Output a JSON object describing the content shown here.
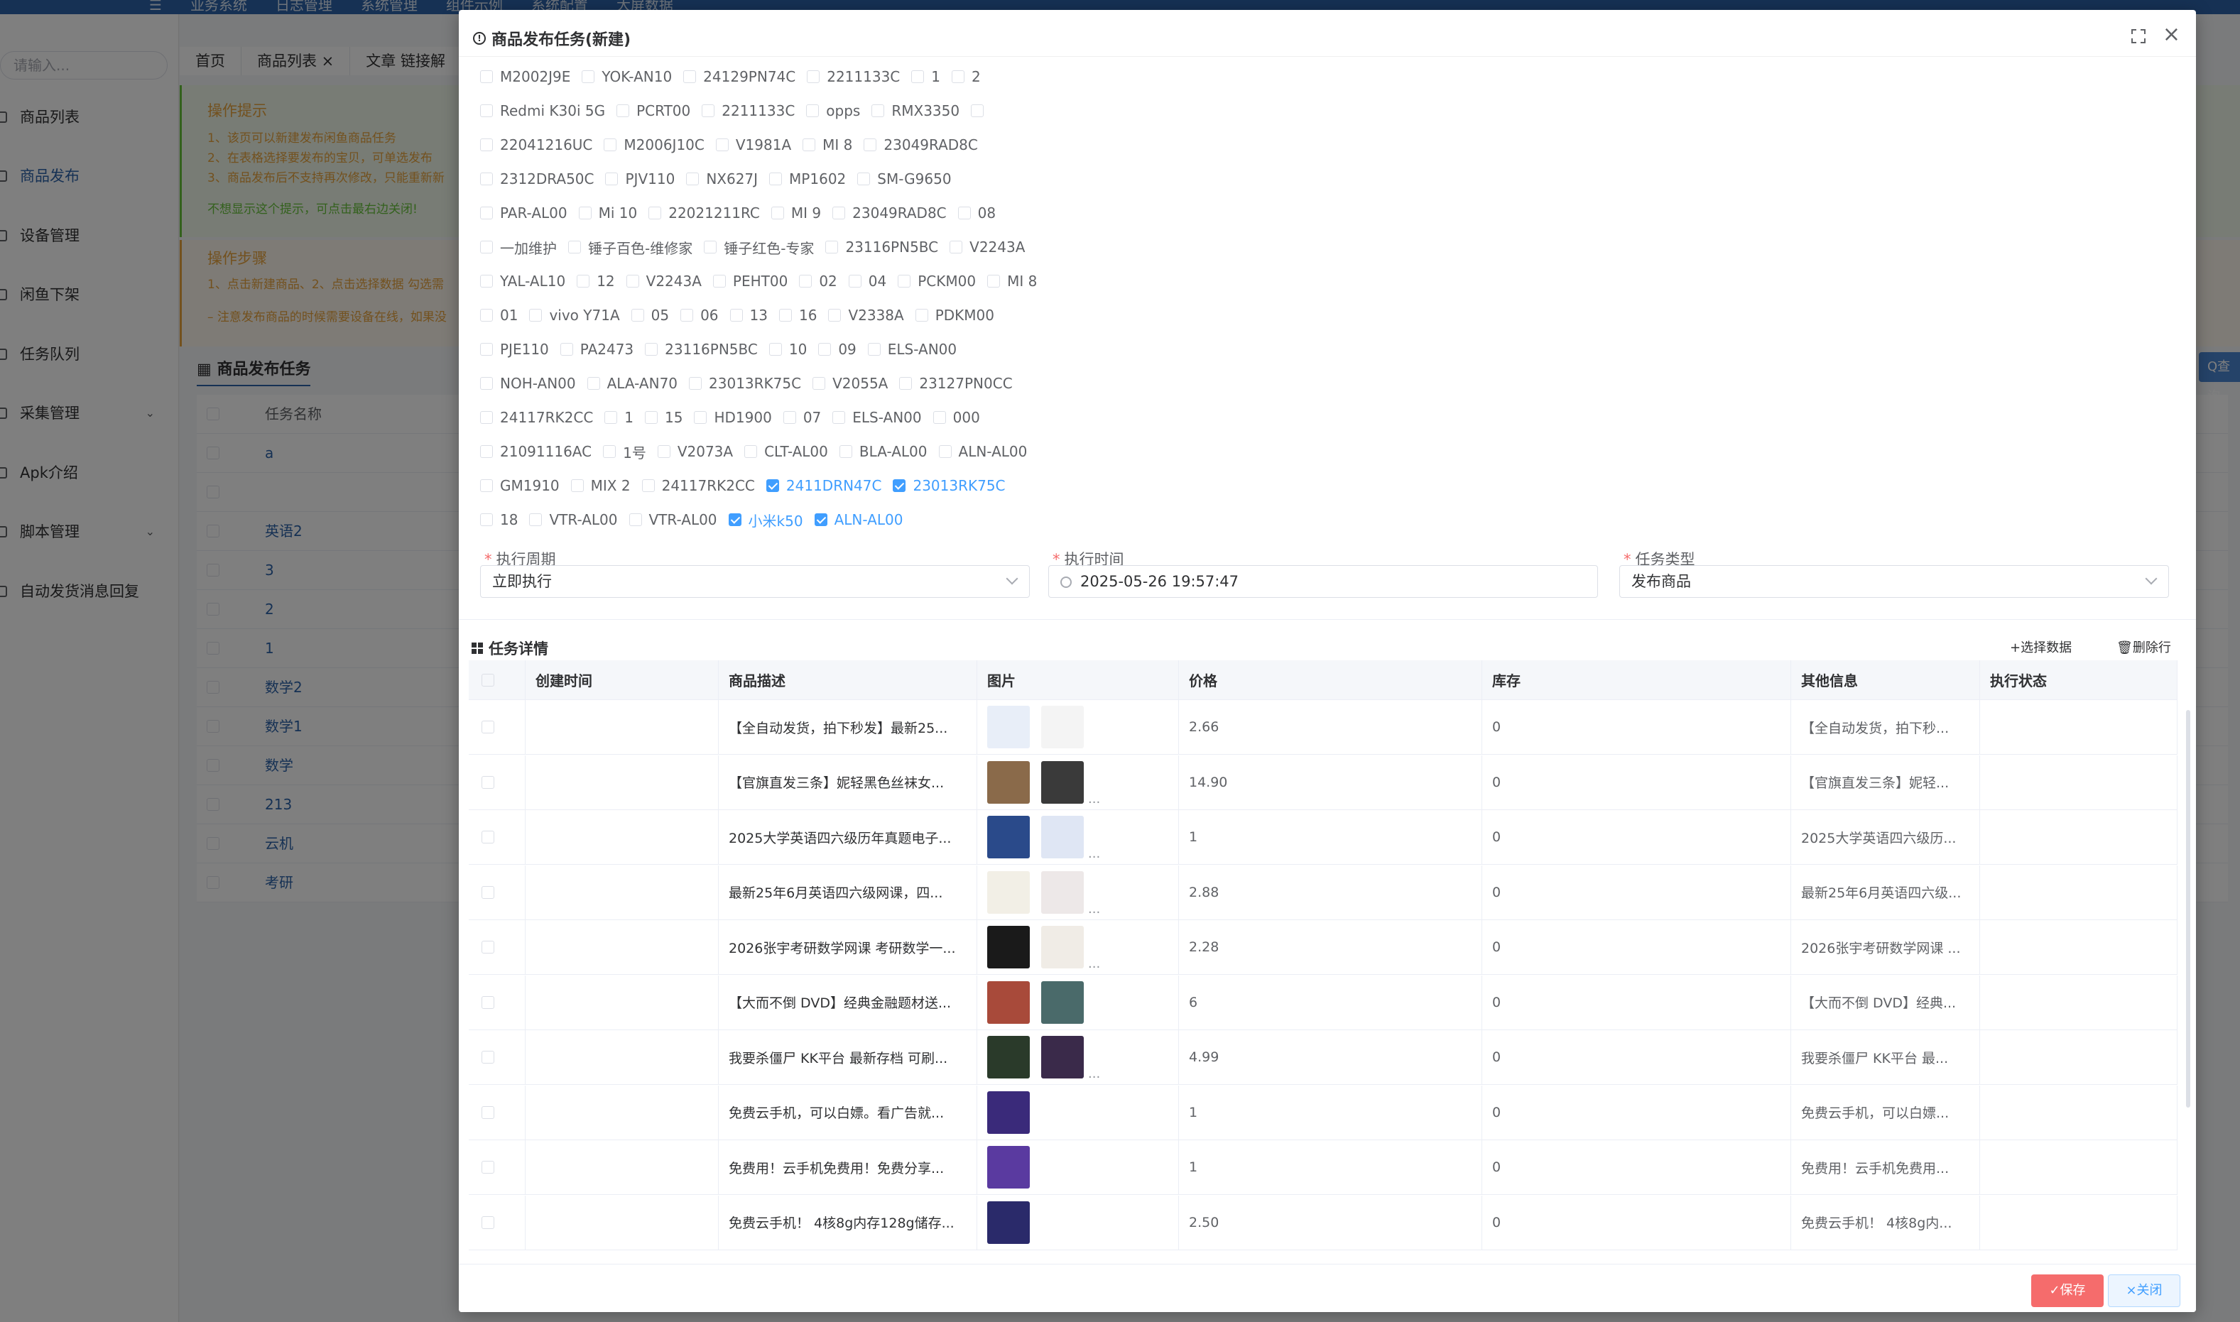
{
  "topnav": [
    "☰",
    "业务系统",
    "日志管理",
    "系统管理",
    "组件示例",
    "系统配置",
    "大屏数据"
  ],
  "sidebar": {
    "search_placeholder": "请输入...",
    "items": [
      {
        "label": "商品列表"
      },
      {
        "label": "商品发布",
        "active": true
      },
      {
        "label": "设备管理"
      },
      {
        "label": "闲鱼下架"
      },
      {
        "label": "任务队列"
      },
      {
        "label": "采集管理",
        "arrow": true
      },
      {
        "label": "Apk介绍"
      },
      {
        "label": "脚本管理",
        "arrow": true
      },
      {
        "label": "自动发货消息回复"
      }
    ]
  },
  "tabs": [
    "首页",
    "商品列表 ×",
    "文章 链接解"
  ],
  "notice": {
    "title1": "操作提示",
    "lines": [
      "1、该页可以新建发布闲鱼商品任务",
      "2、在表格选择要发布的宝贝，可单选发布",
      "3、商品发布后不支持再次修改，只能重新新",
      "不想显示这个提示，可点击最右边关闭!"
    ],
    "title2": "操作步骤",
    "lines2": [
      "1、点击新建商品、2、点击选择数据 勾选需",
      "– 注意发布商品的时候需要设备在线，如果没"
    ]
  },
  "list": {
    "title": "商品发布任务",
    "header": "任务名称",
    "rows": [
      "a",
      "",
      "英语2",
      "3",
      "2",
      "1",
      "数学2",
      "数学1",
      "数学",
      "213",
      "云机",
      "考研"
    ]
  },
  "query_btn": "Q查询",
  "modal": {
    "title": "商品发布任务(新建)",
    "device_rows": [
      [
        [
          "M2002J9E",
          0
        ],
        [
          "YOK-AN10",
          0
        ],
        [
          "24129PN74C",
          0
        ],
        [
          "2211133C",
          0
        ],
        [
          "1",
          0
        ],
        [
          "2",
          0
        ]
      ],
      [
        [
          "Redmi K30i 5G",
          0
        ],
        [
          "PCRT00",
          0
        ],
        [
          "2211133C",
          0
        ],
        [
          "opps",
          0
        ],
        [
          "RMX3350",
          0
        ],
        [
          "",
          0
        ]
      ],
      [
        [
          "22041216UC",
          0
        ],
        [
          "M2006J10C",
          0
        ],
        [
          "V1981A",
          0
        ],
        [
          "MI 8",
          0
        ],
        [
          "23049RAD8C",
          0
        ]
      ],
      [
        [
          "2312DRA50C",
          0
        ],
        [
          "PJV110",
          0
        ],
        [
          "NX627J",
          0
        ],
        [
          "MP1602",
          0
        ],
        [
          "SM-G9650",
          0
        ]
      ],
      [
        [
          "PAR-AL00",
          0
        ],
        [
          "Mi 10",
          0
        ],
        [
          "22021211RC",
          0
        ],
        [
          "MI 9",
          0
        ],
        [
          "23049RAD8C",
          0
        ],
        [
          "08",
          0
        ]
      ],
      [
        [
          "一加维护",
          0
        ],
        [
          "锤子百色-维修家",
          0
        ],
        [
          "锤子红色-专家",
          0
        ],
        [
          "23116PN5BC",
          0
        ],
        [
          "V2243A",
          0
        ]
      ],
      [
        [
          "YAL-AL10",
          0
        ],
        [
          "12",
          0
        ],
        [
          "V2243A",
          0
        ],
        [
          "PEHT00",
          0
        ],
        [
          "02",
          0
        ],
        [
          "04",
          0
        ],
        [
          "PCKM00",
          0
        ],
        [
          "MI 8",
          0
        ]
      ],
      [
        [
          "01",
          0
        ],
        [
          "vivo Y71A",
          0
        ],
        [
          "05",
          0
        ],
        [
          "06",
          0
        ],
        [
          "13",
          0
        ],
        [
          "16",
          0
        ],
        [
          "V2338A",
          0
        ],
        [
          "PDKM00",
          0
        ]
      ],
      [
        [
          "PJE110",
          0
        ],
        [
          "PA2473",
          0
        ],
        [
          "23116PN5BC",
          0
        ],
        [
          "10",
          0
        ],
        [
          "09",
          0
        ],
        [
          "ELS-AN00",
          0
        ]
      ],
      [
        [
          "NOH-AN00",
          0
        ],
        [
          "ALA-AN70",
          0
        ],
        [
          "23013RK75C",
          0
        ],
        [
          "V2055A",
          0
        ],
        [
          "23127PN0CC",
          0
        ]
      ],
      [
        [
          "24117RK2CC",
          0
        ],
        [
          "1",
          0
        ],
        [
          "15",
          0
        ],
        [
          "HD1900",
          0
        ],
        [
          "07",
          0
        ],
        [
          "ELS-AN00",
          0
        ],
        [
          "000",
          0
        ]
      ],
      [
        [
          "21091116AC",
          0
        ],
        [
          "1号",
          0
        ],
        [
          "V2073A",
          0
        ],
        [
          "CLT-AL00",
          0
        ],
        [
          "BLA-AL00",
          0
        ],
        [
          "ALN-AL00",
          0
        ]
      ],
      [
        [
          "GM1910",
          0
        ],
        [
          "MIX 2",
          0
        ],
        [
          "24117RK2CC",
          0
        ],
        [
          "2411DRN47C",
          1
        ],
        [
          "23013RK75C",
          1
        ]
      ],
      [
        [
          "18",
          0
        ],
        [
          "VTR-AL00",
          0
        ],
        [
          "VTR-AL00",
          0
        ],
        [
          "小米k50",
          1
        ],
        [
          "ALN-AL00",
          1
        ]
      ]
    ],
    "form": {
      "period_label": "执行周期",
      "period_value": "立即执行",
      "time_label": "执行时间",
      "time_value": "2025-05-26 19:57:47",
      "type_label": "任务类型",
      "type_value": "发布商品"
    },
    "detail_title": "任务详情",
    "btn_select": "+选择数据",
    "btn_delete": "🗑删除行",
    "columns": [
      "创建时间",
      "商品描述",
      "图片",
      "价格",
      "库存",
      "其他信息",
      "执行状态"
    ],
    "rows": [
      {
        "desc": "【全自动发货，拍下秒发】最新25...",
        "price": "2.66",
        "stock": "0",
        "other": "【全自动发货，拍下秒...",
        "thumbs": 2,
        "more": false,
        "c1": "#e8eef8",
        "c2": "#f4f4f4"
      },
      {
        "desc": "【官旗直发三条】妮轻黑色丝袜女...",
        "price": "14.90",
        "stock": "0",
        "other": "【官旗直发三条】妮轻...",
        "thumbs": 2,
        "more": true,
        "c1": "#8a6a4a",
        "c2": "#3a3a3a"
      },
      {
        "desc": "2025大学英语四六级历年真题电子...",
        "price": "1",
        "stock": "0",
        "other": "2025大学英语四六级历...",
        "thumbs": 2,
        "more": true,
        "c1": "#2a4a8a",
        "c2": "#dfe6f4"
      },
      {
        "desc": "最新25年6月英语四六级网课，四...",
        "price": "2.88",
        "stock": "0",
        "other": "最新25年6月英语四六级...",
        "thumbs": 2,
        "more": true,
        "c1": "#f2efe6",
        "c2": "#ede8e8"
      },
      {
        "desc": "2026张宇考研数学网课 考研数学一...",
        "price": "2.28",
        "stock": "0",
        "other": "2026张宇考研数学网课 ...",
        "thumbs": 2,
        "more": true,
        "c1": "#1a1a1a",
        "c2": "#f0ece6"
      },
      {
        "desc": "【大而不倒 DVD】经典金融题材送...",
        "price": "6",
        "stock": "0",
        "other": "【大而不倒 DVD】经典...",
        "thumbs": 2,
        "more": false,
        "c1": "#a84a3a",
        "c2": "#4a6a6a"
      },
      {
        "desc": "我要杀僵尸 KK平台 最新存档 可刷...",
        "price": "4.99",
        "stock": "0",
        "other": "我要杀僵尸 KK平台 最...",
        "thumbs": 2,
        "more": true,
        "c1": "#2a3a2a",
        "c2": "#3a2a4a"
      },
      {
        "desc": "免费云手机，可以白嫖。看广告就...",
        "price": "1",
        "stock": "0",
        "other": "免费云手机，可以白嫖...",
        "thumbs": 1,
        "more": false,
        "c1": "#3a2a7a",
        "c2": ""
      },
      {
        "desc": "免费用！云手机免费用！免费分享...",
        "price": "1",
        "stock": "0",
        "other": "免费用！云手机免费用...",
        "thumbs": 1,
        "more": false,
        "c1": "#5a3aa0",
        "c2": ""
      },
      {
        "desc": "免费云手机！ 4核8g内存128g储存...",
        "price": "2.50",
        "stock": "0",
        "other": "免费云手机！ 4核8g内...",
        "thumbs": 1,
        "more": false,
        "c1": "#2a2a6a",
        "c2": ""
      }
    ],
    "btn_save": "✓保存",
    "btn_close": "×关闭"
  }
}
